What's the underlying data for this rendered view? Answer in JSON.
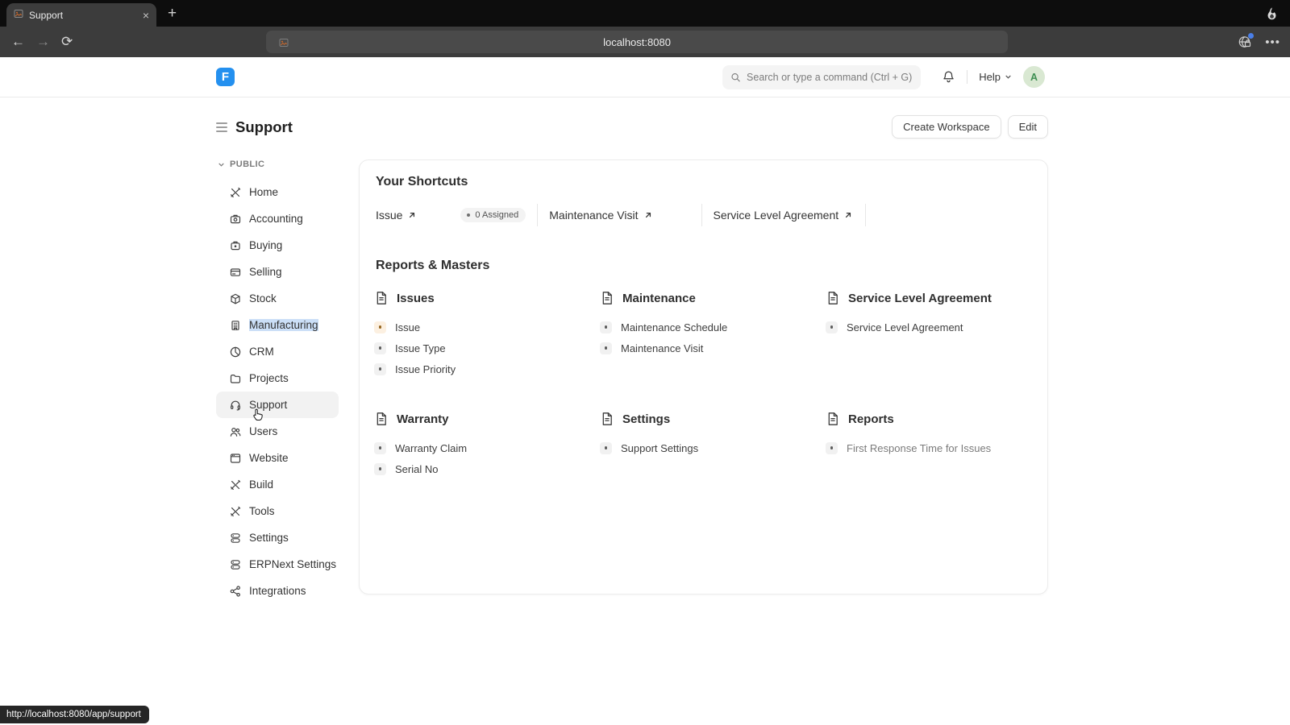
{
  "browser": {
    "tab_title": "Support",
    "url": "localhost:8080",
    "status_url": "http://localhost:8080/app/support"
  },
  "header": {
    "search_placeholder": "Search or type a command (Ctrl + G)",
    "help_label": "Help",
    "avatar_letter": "A"
  },
  "page": {
    "title": "Support",
    "create_workspace_label": "Create Workspace",
    "edit_label": "Edit"
  },
  "sidebar": {
    "section_label": "PUBLIC",
    "items": [
      {
        "label": "Home",
        "icon": "home-icon"
      },
      {
        "label": "Accounting",
        "icon": "accounting-icon"
      },
      {
        "label": "Buying",
        "icon": "buying-icon"
      },
      {
        "label": "Selling",
        "icon": "selling-icon"
      },
      {
        "label": "Stock",
        "icon": "stock-icon"
      },
      {
        "label": "Manufacturing",
        "icon": "manufacturing-icon",
        "highlighted": true
      },
      {
        "label": "CRM",
        "icon": "crm-icon"
      },
      {
        "label": "Projects",
        "icon": "projects-icon"
      },
      {
        "label": "Support",
        "icon": "support-icon",
        "active": true
      },
      {
        "label": "Users",
        "icon": "users-icon"
      },
      {
        "label": "Website",
        "icon": "website-icon"
      },
      {
        "label": "Build",
        "icon": "build-icon"
      },
      {
        "label": "Tools",
        "icon": "tools-icon"
      },
      {
        "label": "Settings",
        "icon": "settings-icon"
      },
      {
        "label": "ERPNext Settings",
        "icon": "erpnext-settings-icon"
      },
      {
        "label": "Integrations",
        "icon": "integrations-icon"
      }
    ]
  },
  "shortcuts": {
    "title": "Your Shortcuts",
    "items": [
      {
        "label": "Issue",
        "badge": "0 Assigned"
      },
      {
        "label": "Maintenance Visit"
      },
      {
        "label": "Service Level Agreement"
      }
    ]
  },
  "reports_masters": {
    "title": "Reports & Masters",
    "cards": [
      {
        "title": "Issues",
        "links": [
          {
            "label": "Issue",
            "accent": true
          },
          {
            "label": "Issue Type"
          },
          {
            "label": "Issue Priority"
          }
        ]
      },
      {
        "title": "Maintenance",
        "links": [
          {
            "label": "Maintenance Schedule"
          },
          {
            "label": "Maintenance Visit"
          }
        ]
      },
      {
        "title": "Service Level Agreement",
        "links": [
          {
            "label": "Service Level Agreement"
          }
        ]
      },
      {
        "title": "Warranty",
        "links": [
          {
            "label": "Warranty Claim"
          },
          {
            "label": "Serial No"
          }
        ]
      },
      {
        "title": "Settings",
        "links": [
          {
            "label": "Support Settings"
          }
        ]
      },
      {
        "title": "Reports",
        "links": [
          {
            "label": "First Response Time for Issues",
            "muted": true
          }
        ]
      }
    ]
  },
  "colors": {
    "brand": "#2490ef",
    "avatar_bg": "#d9e8d2",
    "avatar_text": "#3e8e52",
    "accent_bullet_bg": "#fcf0e1",
    "accent_bullet_dot": "#96661f",
    "selection_highlight": "#cbdff7"
  }
}
